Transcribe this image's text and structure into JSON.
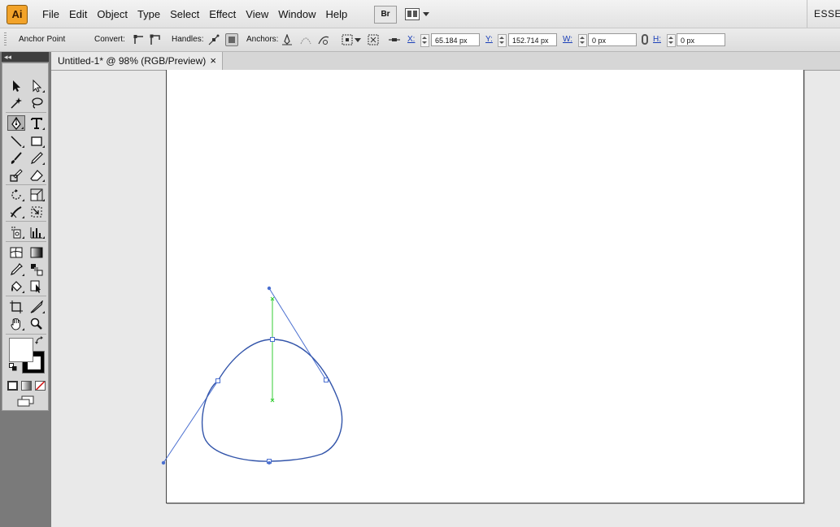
{
  "app": {
    "logo": "Ai",
    "menu": [
      "File",
      "Edit",
      "Object",
      "Type",
      "Select",
      "Effect",
      "View",
      "Window",
      "Help"
    ],
    "bridge_label": "Br",
    "workspace_label": "ESSEN"
  },
  "control_bar": {
    "tool_label": "Anchor Point",
    "convert_label": "Convert:",
    "handles_label": "Handles:",
    "anchors_label": "Anchors:",
    "x_label": "X:",
    "x_value": "65.184 px",
    "y_label": "Y:",
    "y_value": "152.714 px",
    "w_label": "W:",
    "w_value": "0 px",
    "h_label": "H:",
    "h_value": "0 px"
  },
  "toolbox": {
    "collapse_label": "◂◂",
    "active_tool": "pen-tool"
  },
  "document": {
    "tab_title": "Untitled-1* @ 98% (RGB/Preview)",
    "close_glyph": "×"
  },
  "colors": {
    "path": "#3355aa",
    "selection": "#4a6fd0",
    "guide": "#33cc33",
    "artboard": "#ffffff"
  }
}
